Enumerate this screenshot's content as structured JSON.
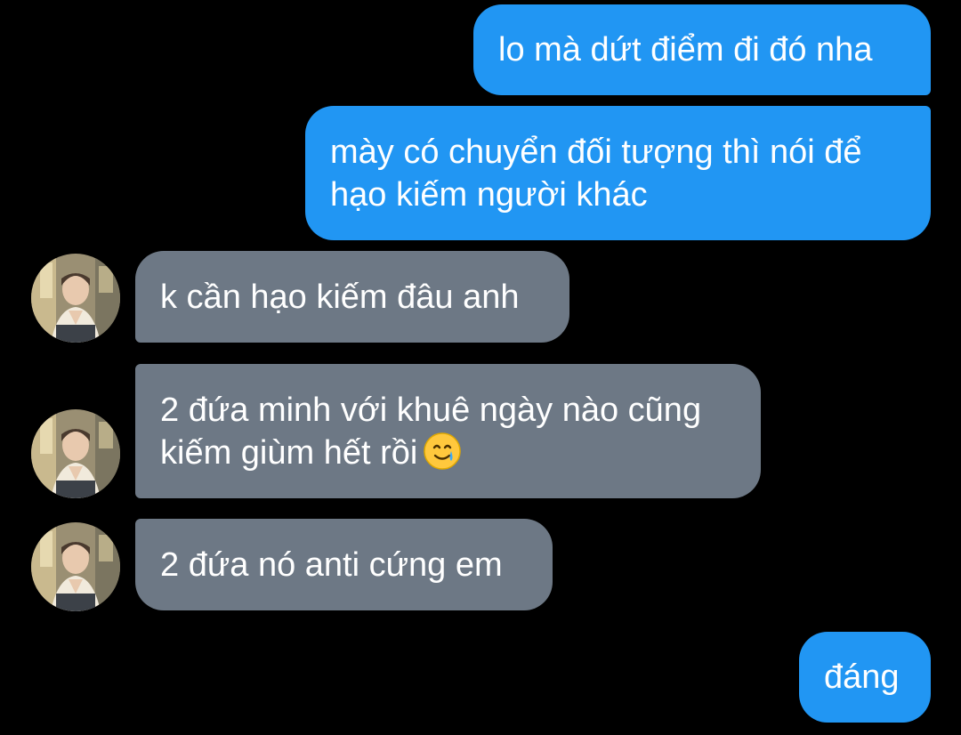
{
  "messages": [
    {
      "side": "sent",
      "text": "lo mà dứt điểm đi đó nha"
    },
    {
      "side": "sent",
      "text": "mày có chuyển đối tượng thì nói để\nhạo kiếm người khác"
    },
    {
      "side": "received",
      "text": "k cần hạo kiếm đâu anh"
    },
    {
      "side": "received",
      "text": "2 đứa minh với khuê ngày nào cũng\nkiếm giùm hết rồi",
      "emoji": "smiling-face-with-tear-icon"
    },
    {
      "side": "received",
      "text": "2 đứa nó anti cứng em"
    },
    {
      "side": "sent",
      "text": "đáng"
    }
  ],
  "colors": {
    "background": "#000000",
    "sent_bubble": "#2196F3",
    "received_bubble": "#6D7885",
    "text": "#FFFFFF"
  },
  "avatar_icon": "contact-avatar-photo"
}
